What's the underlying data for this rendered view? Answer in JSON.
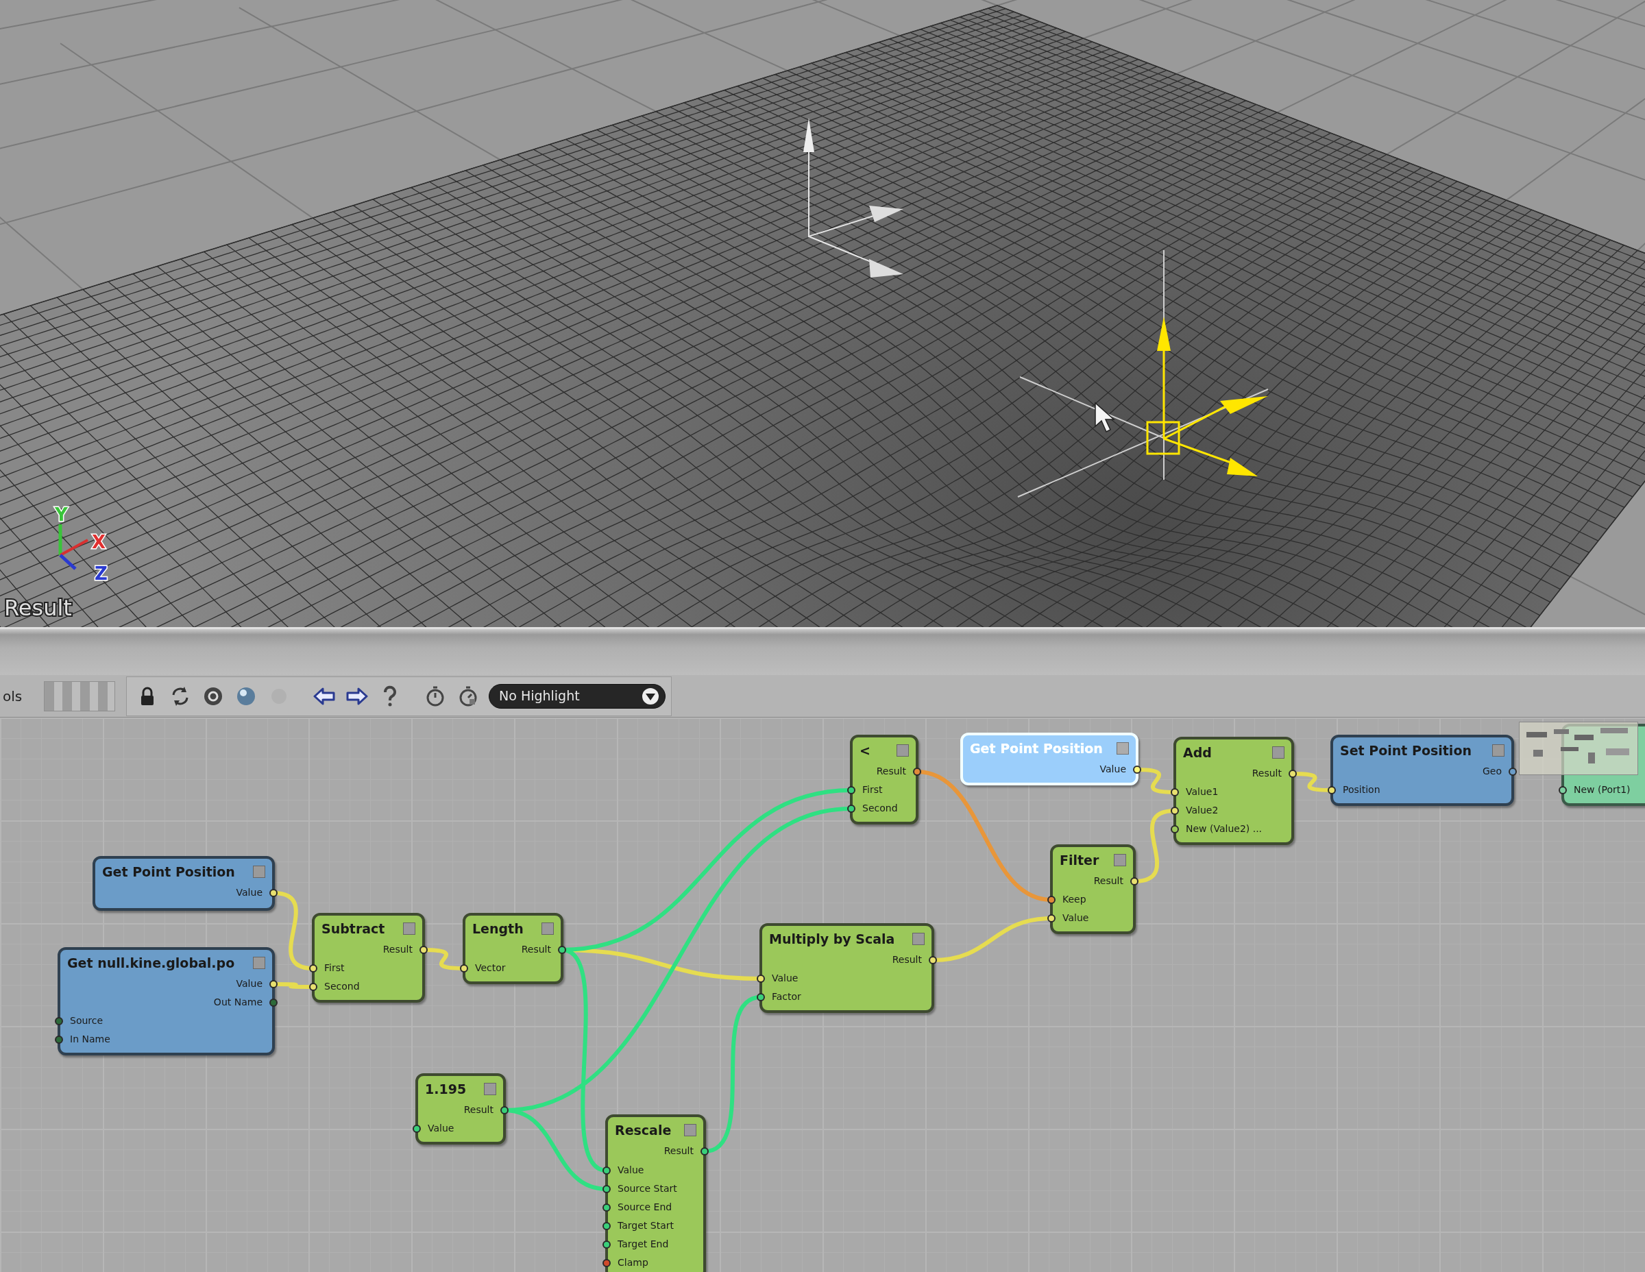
{
  "viewport": {
    "label": "Result",
    "axis_labels": [
      {
        "text": "Y",
        "color": "#3ac43a"
      },
      {
        "text": "X",
        "color": "#e03030"
      },
      {
        "text": "Z",
        "color": "#2a3ad0"
      }
    ]
  },
  "toolbar": {
    "label": "ols",
    "buttons": [
      {
        "kind": "lock",
        "disabled": false
      },
      {
        "kind": "refresh",
        "disabled": false
      },
      {
        "kind": "record",
        "disabled": false
      },
      {
        "kind": "sphere",
        "disabled": false
      },
      {
        "kind": "blank",
        "disabled": true
      },
      {
        "kind": "back",
        "disabled": false
      },
      {
        "kind": "forward",
        "disabled": false
      },
      {
        "kind": "help",
        "disabled": false
      },
      {
        "kind": "timer",
        "disabled": false
      },
      {
        "kind": "timer-alt",
        "disabled": false
      }
    ],
    "highlight": {
      "value": "No Highlight"
    }
  },
  "graph": {
    "nodes": [
      {
        "kind": "operator",
        "selected": false,
        "title": "<",
        "outputs": [
          {
            "label": "Result",
            "color": "#e08a3a"
          }
        ],
        "inputs": [
          {
            "label": "First",
            "color": "#3ad07a"
          },
          {
            "label": "Second",
            "color": "#3ad07a"
          }
        ]
      },
      {
        "kind": "data",
        "selected": true,
        "title": "Get Point Position",
        "outputs": [
          {
            "label": "Value",
            "color": "#e8e070"
          }
        ]
      },
      {
        "kind": "operator",
        "selected": false,
        "title": "Add",
        "outputs": [
          {
            "label": "Result",
            "color": "#e8e070"
          }
        ],
        "inputs": [
          {
            "label": "Value1",
            "color": "#e8e070"
          },
          {
            "label": "Value2",
            "color": "#e8e070"
          },
          {
            "label": "New (Value2) ...",
            "color": "#9bc85a"
          }
        ]
      },
      {
        "kind": "data",
        "selected": false,
        "title": "Set Point Position",
        "outputs": [
          {
            "label": "Geo",
            "color": "#6b9cc8"
          }
        ],
        "inputs": [
          {
            "label": "Position",
            "color": "#e8e070"
          }
        ]
      },
      {
        "kind": "tree",
        "selected": false,
        "inputs": [
          {
            "label": "New (Port1)",
            "color": "#7ecfa0"
          }
        ]
      },
      {
        "kind": "data",
        "selected": false,
        "title": "Get Point Position",
        "outputs": [
          {
            "label": "Value",
            "color": "#e8e070"
          }
        ]
      },
      {
        "kind": "operator",
        "selected": false,
        "title": "Filter",
        "outputs": [
          {
            "label": "Result",
            "color": "#e8e070"
          }
        ],
        "inputs": [
          {
            "label": "Keep",
            "color": "#e08a3a"
          },
          {
            "label": "Value",
            "color": "#e8e070"
          }
        ]
      },
      {
        "kind": "operator",
        "selected": false,
        "title": "Subtract",
        "outputs": [
          {
            "label": "Result",
            "color": "#e8e070"
          }
        ],
        "inputs": [
          {
            "label": "First",
            "color": "#e8e070"
          },
          {
            "label": "Second",
            "color": "#e8e070"
          }
        ]
      },
      {
        "kind": "operator",
        "selected": false,
        "title": "Length",
        "outputs": [
          {
            "label": "Result",
            "color": "#3ad07a"
          }
        ],
        "inputs": [
          {
            "label": "Vector",
            "color": "#e8e070"
          }
        ]
      },
      {
        "kind": "operator",
        "selected": false,
        "title": "Multiply by Scala",
        "outputs": [
          {
            "label": "Result",
            "color": "#e8e070"
          }
        ],
        "inputs": [
          {
            "label": "Value",
            "color": "#e8e070"
          },
          {
            "label": "Factor",
            "color": "#3ad07a"
          }
        ]
      },
      {
        "kind": "data",
        "selected": false,
        "title": "Get null.kine.global.po",
        "outputs": [
          {
            "label": "Value",
            "color": "#e8e070"
          },
          {
            "label": "Out Name",
            "color": "#2d6a3a"
          }
        ],
        "inputs": [
          {
            "label": "Source",
            "color": "#2d6a3a"
          },
          {
            "label": "In Name",
            "color": "#2d6a3a"
          }
        ]
      },
      {
        "kind": "operator",
        "selected": false,
        "title": "1.195",
        "outputs": [
          {
            "label": "Result",
            "color": "#3ad07a"
          }
        ],
        "inputs": [
          {
            "label": "Value",
            "color": "#3ad07a"
          }
        ]
      },
      {
        "kind": "operator",
        "selected": false,
        "title": "Rescale",
        "outputs": [
          {
            "label": "Result",
            "color": "#3ad07a"
          }
        ],
        "inputs": [
          {
            "label": "Value",
            "color": "#3ad07a"
          },
          {
            "label": "Source Start",
            "color": "#3ad07a"
          },
          {
            "label": "Source End",
            "color": "#3ad07a"
          },
          {
            "label": "Target Start",
            "color": "#3ad07a"
          },
          {
            "label": "Target End",
            "color": "#3ad07a"
          },
          {
            "label": "Clamp",
            "color": "#d04a2a"
          }
        ]
      }
    ]
  }
}
